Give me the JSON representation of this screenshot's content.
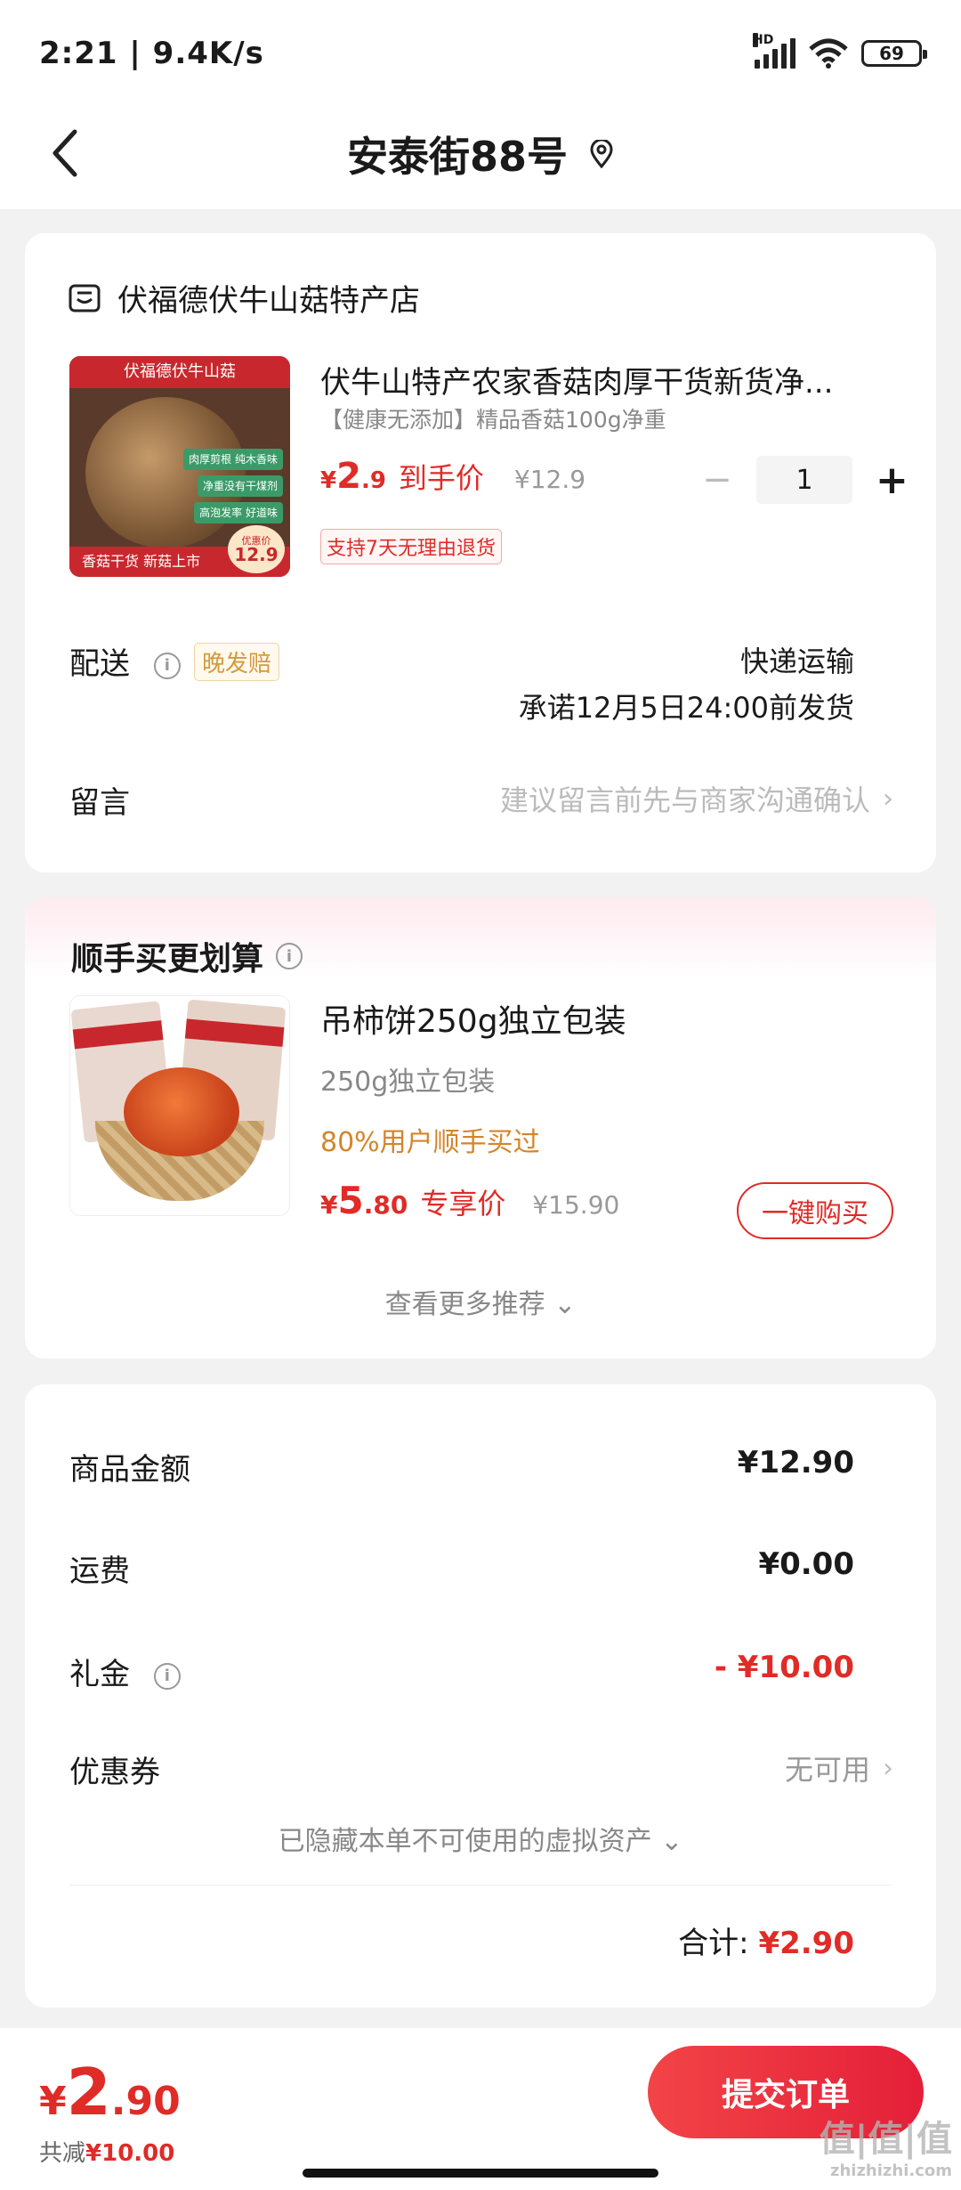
{
  "status_bar": {
    "time": "2:21 | 9.4K/s",
    "battery": "69",
    "network": "HD"
  },
  "nav": {
    "title": "安泰街88号"
  },
  "shop": {
    "name": "伏福德伏牛山菇特产店"
  },
  "product": {
    "image_banner": "伏福德伏牛山菇",
    "image_tags": [
      "肉厚剪根 纯木香味",
      "净重没有干煤剂",
      "高泡发率 好道味"
    ],
    "image_bottom": "香菇干货 新菇上市",
    "image_badge_label": "优惠价",
    "image_badge_price": "12.9",
    "title": "伏牛山特产农家香菇肉厚干货新货净...",
    "subtitle": "【健康无添加】精品香菇100g净重",
    "price_symbol": "¥",
    "price_int": "2",
    "price_dec": ".9",
    "price_label": "到手价",
    "orig_price": "¥12.9",
    "quantity": "1",
    "minus": "−",
    "plus": "+",
    "return_tag": "支持7天无理由退货"
  },
  "delivery": {
    "label": "配送",
    "info": "i",
    "late_badge": "晚发赔",
    "method": "快递运输",
    "promise": "承诺12月5日24:00前发货"
  },
  "message": {
    "label": "留言",
    "placeholder": "建议留言前先与商家沟通确认",
    "chevron": "›"
  },
  "recommend": {
    "title": "顺手买更划算",
    "info": "i",
    "item_title": "吊柿饼250g独立包装",
    "item_sub": "250g独立包装",
    "item_pct": "80%用户顺手买过",
    "price_symbol": "¥",
    "price_int": "5",
    "price_dec": ".80",
    "price_label": "专享价",
    "orig_price": "¥15.90",
    "buy_label": "一键购买",
    "more_label": "查看更多推荐 ⌄"
  },
  "summary": {
    "goods_label": "商品金额",
    "goods_value": "¥12.90",
    "freight_label": "运费",
    "freight_value": "¥0.00",
    "gift_label": "礼金",
    "gift_info": "i",
    "gift_value": "- ¥10.00",
    "coupon_label": "优惠券",
    "coupon_value": "无可用",
    "coupon_chevron": "›",
    "hidden_assets": "已隐藏本单不可使用的虚拟资产 ⌄",
    "total_label": "合计:",
    "total_value": "¥2.90"
  },
  "bottom": {
    "price_symbol": "¥",
    "price_int": "2",
    "price_dec": ".90",
    "saved_label": "共减",
    "saved_value": "¥10.00",
    "submit_label": "提交订单"
  },
  "watermark": {
    "text": "值|值|值",
    "domain": "zhizhizhi.com"
  },
  "colors": {
    "accent": "#e02b27",
    "orange": "#d4852a",
    "bg": "#f2f2f2"
  }
}
